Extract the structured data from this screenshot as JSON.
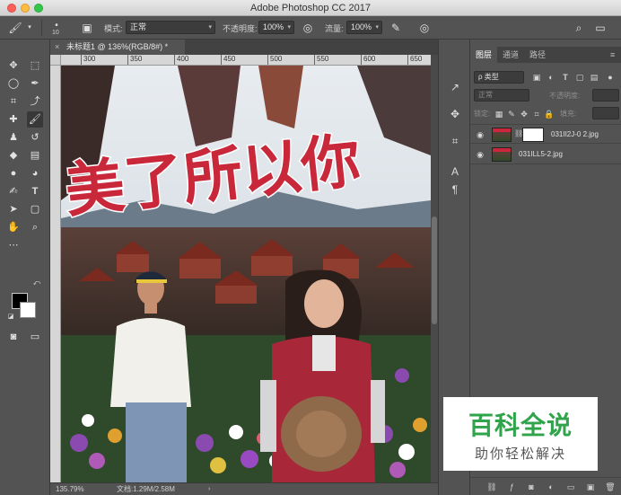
{
  "window": {
    "title": "Adobe Photoshop CC 2017"
  },
  "options_bar": {
    "brush_size": "10",
    "mode_label": "模式:",
    "mode_value": "正常",
    "opacity_label": "不透明度:",
    "opacity_value": "100%",
    "flow_label": "流量:",
    "flow_value": "100%"
  },
  "document": {
    "tab_title": "未标题1 @ 136%(RGB/8#) *",
    "close_glyph": "×",
    "ruler_ticks": [
      "300",
      "350",
      "400",
      "450",
      "500",
      "550",
      "600",
      "650"
    ],
    "zoom": "135.79%",
    "doc_info": "文档:1.29M/2.58M",
    "banner_text": "美了所以你"
  },
  "panel": {
    "tabs": [
      {
        "label": "图层",
        "active": true
      },
      {
        "label": "通道",
        "active": false
      },
      {
        "label": "路径",
        "active": false
      }
    ],
    "filter_label": "ρ 类型",
    "blend_mode": "正常",
    "opacity_label": "不透明度:",
    "lock_label": "锁定:",
    "fill_label": "填充:",
    "layers": [
      {
        "name": "031II2J-0 2.jpg",
        "has_mask": true
      },
      {
        "name": "031ILL5-2.jpg",
        "has_mask": false
      }
    ]
  },
  "watermark": {
    "title": "百科全说",
    "subtitle": "助你轻松解决"
  },
  "colors": {
    "accent_green": "#2fa44a",
    "ui_gray": "#535353",
    "banner_red": "#c8283a"
  }
}
